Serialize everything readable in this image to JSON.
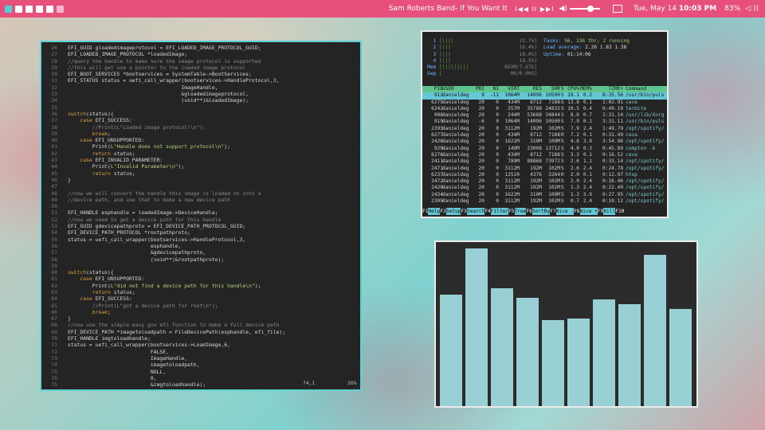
{
  "topbar": {
    "workspaces": [
      {
        "state": "active"
      },
      {
        "state": "normal"
      },
      {
        "state": "normal"
      },
      {
        "state": "normal"
      },
      {
        "state": "normal"
      },
      {
        "state": "dim"
      }
    ],
    "song": "Sam Roberts Band- If You Want It",
    "media_controls": "I◀◀ II ▶▶I",
    "volume_icon": "speaker-icon",
    "clock_day": "Tue, May 14",
    "clock_time": "10:03 PM",
    "battery": "83%",
    "wifi_icon": "wifi-icon",
    "accent_color": "#e8507c"
  },
  "editor": {
    "lines": [
      {
        "n": "26",
        "parts": [
          [
            "def",
            "EFI_GUID gloadedimageprotocol = EFI_LOADED_IMAGE_PROTOCOL_GUID;"
          ]
        ]
      },
      {
        "n": "27",
        "parts": [
          [
            "def",
            "EFI_LOADED_IMAGE_PROTOCOL *loadedImage;"
          ]
        ]
      },
      {
        "n": "28",
        "parts": [
          [
            "com",
            "//query the handle to make sure the image protocol is supported"
          ]
        ]
      },
      {
        "n": "29",
        "parts": [
          [
            "com",
            "//this will get use a pointer to the loaded image protocol"
          ]
        ]
      },
      {
        "n": "30",
        "parts": [
          [
            "def",
            "EFI_BOOT_SERVICES *bootservices = SystemTable->BootServices;"
          ]
        ]
      },
      {
        "n": "31",
        "parts": [
          [
            "def",
            "EFI_STATUS status = uefi_call_wrapper(bootservices->HandleProtocol,3,"
          ]
        ]
      },
      {
        "n": "32",
        "parts": [
          [
            "def",
            "                                     ImageHandle,"
          ]
        ]
      },
      {
        "n": "33",
        "parts": [
          [
            "def",
            "                                     &gloadedimageprotocol,"
          ]
        ]
      },
      {
        "n": "34",
        "parts": [
          [
            "def",
            "                                     (void**)&loadedImage);"
          ]
        ]
      },
      {
        "n": "35",
        "parts": [
          [
            "def",
            ""
          ]
        ]
      },
      {
        "n": "36",
        "parts": [
          [
            "kw",
            "switch"
          ],
          [
            "def",
            "(status){"
          ]
        ]
      },
      {
        "n": "37",
        "parts": [
          [
            "kw",
            "    case "
          ],
          [
            "def",
            "EFI_SUCCESS:"
          ]
        ]
      },
      {
        "n": "38",
        "parts": [
          [
            "com",
            "        //Print(L\"Loaded image protocol!\\n\");"
          ]
        ]
      },
      {
        "n": "39",
        "parts": [
          [
            "kw",
            "        break"
          ],
          [
            "def",
            ";"
          ]
        ]
      },
      {
        "n": "40",
        "parts": [
          [
            "kw",
            "    case "
          ],
          [
            "def",
            "EFI_UNSUPPORTED:"
          ]
        ]
      },
      {
        "n": "41",
        "parts": [
          [
            "def",
            "        Print("
          ],
          [
            "str",
            "L\"Handle does not support protocol\\n\""
          ],
          [
            "def",
            ");"
          ]
        ]
      },
      {
        "n": "42",
        "parts": [
          [
            "kw",
            "        return "
          ],
          [
            "def",
            "status;"
          ]
        ]
      },
      {
        "n": "43",
        "parts": [
          [
            "kw",
            "    case "
          ],
          [
            "def",
            "EFI_INVALID_PARAMETER:"
          ]
        ]
      },
      {
        "n": "44",
        "parts": [
          [
            "def",
            "        Print("
          ],
          [
            "str",
            "L\"Invalid Parameter\\n\""
          ],
          [
            "def",
            ");"
          ]
        ]
      },
      {
        "n": "45",
        "parts": [
          [
            "kw",
            "        return "
          ],
          [
            "def",
            "status;"
          ]
        ]
      },
      {
        "n": "46",
        "parts": [
          [
            "def",
            "}"
          ]
        ]
      },
      {
        "n": "47",
        "parts": [
          [
            "def",
            ""
          ]
        ]
      },
      {
        "n": "48",
        "parts": [
          [
            "com",
            "//now we will convert the handle this image is loaded on into a"
          ]
        ]
      },
      {
        "n": "49",
        "parts": [
          [
            "com",
            "//device path, and use that to make a new device path"
          ]
        ]
      },
      {
        "n": "50",
        "parts": [
          [
            "def",
            ""
          ]
        ]
      },
      {
        "n": "51",
        "parts": [
          [
            "def",
            "EFI_HANDLE esphandle = loadedImage->DeviceHandle;"
          ]
        ]
      },
      {
        "n": "52",
        "parts": [
          [
            "com",
            "//now we need to get a device path for this handle"
          ]
        ]
      },
      {
        "n": "53",
        "parts": [
          [
            "def",
            "EFI_GUID gdevicepathproto = EFI_DEVICE_PATH_PROTOCOL_GUID;"
          ]
        ]
      },
      {
        "n": "54",
        "parts": [
          [
            "def",
            "EFI_DEVICE_PATH_PROTOCOL *rootpathproto;"
          ]
        ]
      },
      {
        "n": "55",
        "parts": [
          [
            "def",
            "status = uefi_call_wrapper(bootservices->HandleProtocol,3,"
          ]
        ]
      },
      {
        "n": "56",
        "parts": [
          [
            "def",
            "                           esphandle,"
          ]
        ]
      },
      {
        "n": "57",
        "parts": [
          [
            "def",
            "                           &gdevicepathproto,"
          ]
        ]
      },
      {
        "n": "58",
        "parts": [
          [
            "def",
            "                           (void**)&rootpathproto);"
          ]
        ]
      },
      {
        "n": "59",
        "parts": [
          [
            "def",
            ""
          ]
        ]
      },
      {
        "n": "60",
        "parts": [
          [
            "kw",
            "switch"
          ],
          [
            "def",
            "(status){"
          ]
        ]
      },
      {
        "n": "61",
        "parts": [
          [
            "kw",
            "    case "
          ],
          [
            "def",
            "EFI_UNSUPPORTED:"
          ]
        ]
      },
      {
        "n": "62",
        "parts": [
          [
            "def",
            "        Print("
          ],
          [
            "str",
            "L\"did not find a device path for this handle\\n\""
          ],
          [
            "def",
            ");"
          ]
        ]
      },
      {
        "n": "63",
        "parts": [
          [
            "kw",
            "        return "
          ],
          [
            "def",
            "status;"
          ]
        ]
      },
      {
        "n": "64",
        "parts": [
          [
            "kw",
            "    case "
          ],
          [
            "def",
            "EFI_SUCCESS:"
          ]
        ]
      },
      {
        "n": "65",
        "parts": [
          [
            "com",
            "        //Print(L\"got a device path for root\\n\");"
          ]
        ]
      },
      {
        "n": "66",
        "parts": [
          [
            "kw",
            "        break"
          ],
          [
            "def",
            ";"
          ]
        ]
      },
      {
        "n": "67",
        "parts": [
          [
            "def",
            "}"
          ]
        ]
      },
      {
        "n": "68",
        "parts": [
          [
            "com",
            "//now use the simple easy gnu efi function to make a full device path"
          ]
        ]
      },
      {
        "n": "69",
        "parts": [
          [
            "def",
            "EFI_DEVICE_PATH *imagetoloadpath = FileDevicePath(esphandle, efi_file);"
          ]
        ]
      },
      {
        "n": "70",
        "parts": [
          [
            "def",
            "EFI_HANDLE imgtoloadhandle;"
          ]
        ]
      },
      {
        "n": "71",
        "parts": [
          [
            "def",
            "status = uefi_call_wrapper(bootservices->LoadImage,6,"
          ]
        ]
      },
      {
        "n": "72",
        "parts": [
          [
            "def",
            "                           FALSE,"
          ]
        ]
      },
      {
        "n": "73",
        "parts": [
          [
            "def",
            "                           ImageHandle,"
          ]
        ]
      },
      {
        "n": "74",
        "parts": [
          [
            "def",
            "                           imagetoloadpath,"
          ]
        ]
      },
      {
        "n": "75",
        "parts": [
          [
            "def",
            "                           NULL,"
          ]
        ]
      },
      {
        "n": "76",
        "parts": [
          [
            "def",
            "                           0,"
          ]
        ]
      },
      {
        "n": "75",
        "parts": [
          [
            "def",
            "                           &imgtoloadhandle);"
          ]
        ]
      }
    ],
    "cursor_pos": "74,1",
    "scroll_pct": "26%"
  },
  "htop": {
    "cpus": [
      {
        "label": "1",
        "bars": "[||||",
        "pct": "22.7%]"
      },
      {
        "label": "2",
        "bars": "[|||",
        "pct": "16.4%]"
      },
      {
        "label": "3",
        "bars": "[|||",
        "pct": "18.0%]"
      },
      {
        "label": "4",
        "bars": "[|||",
        "pct": "19.5%]"
      }
    ],
    "mem": {
      "label": "Mem",
      "bars": "[|||||||||",
      "pct": "892M/7.67G]"
    },
    "swp": {
      "label": "Swp",
      "bars": "[",
      "pct": "0K/0.00G]"
    },
    "tasks_label": "Tasks: ",
    "tasks_value": "56, 136 thr; 2 running",
    "load_label": "Load average: ",
    "load_value": "2.26 1.83 1.38",
    "uptime_label": "Uptime: ",
    "uptime_value": "01:14:06",
    "columns": [
      "PID",
      "USER",
      "PRI",
      "NI",
      "VIRT",
      "RES",
      "SHR",
      "S",
      "CPU%",
      "MEM%",
      "TIME+",
      "Command"
    ],
    "rows": [
      [
        "912",
        "danieldeg",
        "9",
        "-11",
        "1064M",
        "14096",
        "10500",
        "S",
        "19.1",
        "0.2",
        "8:35.56",
        "/usr/bin/puls"
      ],
      [
        "6275",
        "danieldeg",
        "20",
        "0",
        "434M",
        "8712",
        "7188",
        "S",
        "13.8",
        "0.1",
        "1:02.91",
        "cava"
      ],
      [
        "6242",
        "danieldeg",
        "20",
        "0",
        "357M",
        "35788",
        "24832",
        "S",
        "10.5",
        "0.4",
        "0:49.19",
        "termite"
      ],
      [
        "906",
        "danieldeg",
        "20",
        "0",
        "244M",
        "53688",
        "34844",
        "S",
        "8.6",
        "0.7",
        "2:31.14",
        "/usr/lib/Xorg"
      ],
      [
        "919",
        "danieldeg",
        "-6",
        "0",
        "1064M",
        "14096",
        "10500",
        "S",
        "7.9",
        "0.2",
        "3:31.11",
        "/usr/bin/puls"
      ],
      [
        "2393",
        "danieldeg",
        "20",
        "0",
        "3112M",
        "192M",
        "102M",
        "S",
        "7.9",
        "2.4",
        "1:49.79",
        "/opt/spotify/"
      ],
      [
        "6277",
        "danieldeg",
        "20",
        "0",
        "434M",
        "8712",
        "7188",
        "R",
        "7.2",
        "0.1",
        "0:31.49",
        "cava"
      ],
      [
        "2426",
        "danieldeg",
        "20",
        "0",
        "1622M",
        "310M",
        "109M",
        "S",
        "4.6",
        "3.9",
        "3:54.96",
        "/opt/spotify/"
      ],
      [
        "929",
        "danieldeg",
        "20",
        "0",
        "149M",
        "23008",
        "13712",
        "S",
        "4.0",
        "0.3",
        "0:45.89",
        "compton -b"
      ],
      [
        "6276",
        "danieldeg",
        "20",
        "0",
        "434M",
        "8712",
        "7188",
        "S",
        "3.3",
        "0.1",
        "0:16.52",
        "cava"
      ],
      [
        "2411",
        "danieldeg",
        "20",
        "0",
        "789M",
        "88868",
        "73972",
        "S",
        "2.6",
        "1.1",
        "0:33.14",
        "/opt/spotify/"
      ],
      [
        "2471",
        "danieldeg",
        "20",
        "0",
        "3112M",
        "192M",
        "102M",
        "S",
        "2.6",
        "2.4",
        "0:24.78",
        "/opt/spotify/"
      ],
      [
        "6237",
        "danieldeg",
        "20",
        "0",
        "12520",
        "4376",
        "3264",
        "R",
        "2.0",
        "0.1",
        "0:12.97",
        "htop"
      ],
      [
        "2472",
        "danieldeg",
        "20",
        "0",
        "3112M",
        "192M",
        "102M",
        "S",
        "2.0",
        "2.4",
        "0:16.46",
        "/opt/spotify/"
      ],
      [
        "2420",
        "danieldeg",
        "20",
        "0",
        "3112M",
        "192M",
        "102M",
        "S",
        "1.3",
        "2.4",
        "0:22.49",
        "/opt/spotify/"
      ],
      [
        "2434",
        "danieldeg",
        "20",
        "0",
        "1622M",
        "310M",
        "109M",
        "S",
        "1.3",
        "3.9",
        "0:27.95",
        "/opt/spotify/"
      ],
      [
        "2399",
        "danieldeg",
        "20",
        "0",
        "3112M",
        "192M",
        "102M",
        "S",
        "0.7",
        "2.4",
        "0:10.12",
        "/opt/spotify/"
      ]
    ],
    "fkeys": [
      {
        "key": "F1",
        "label": "Help  "
      },
      {
        "key": "F2",
        "label": "Setup "
      },
      {
        "key": "F3",
        "label": "Search"
      },
      {
        "key": "F4",
        "label": "Filter"
      },
      {
        "key": "F5",
        "label": "Tree  "
      },
      {
        "key": "F6",
        "label": "SortBy"
      },
      {
        "key": "F7",
        "label": "Nice -"
      },
      {
        "key": "F8",
        "label": "Nice +"
      },
      {
        "key": "F9",
        "label": "Kill  "
      },
      {
        "key": "F10",
        "label": ""
      }
    ]
  },
  "cava": {
    "levels": [
      0.7,
      0.99,
      0.74,
      0.68,
      0.54,
      0.55,
      0.67,
      0.64,
      0.95,
      0.61
    ],
    "bar_color": "#98d0d6"
  }
}
